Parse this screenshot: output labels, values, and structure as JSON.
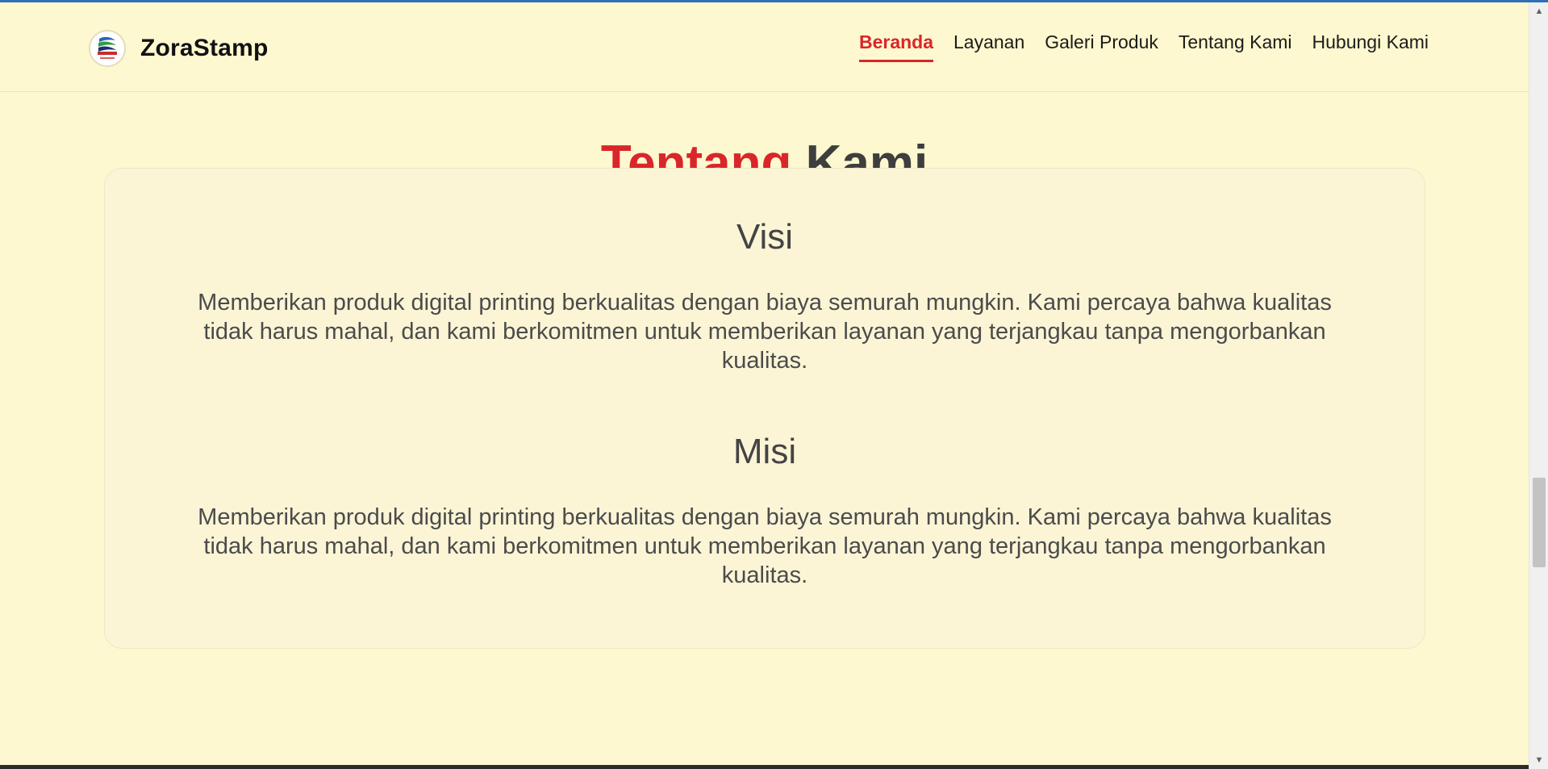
{
  "header": {
    "brand_name": "ZoraStamp",
    "logo_icon": "zora-stamp-logo-icon",
    "nav": [
      {
        "label": "Beranda",
        "active": true
      },
      {
        "label": "Layanan",
        "active": false
      },
      {
        "label": "Galeri Produk",
        "active": false
      },
      {
        "label": "Tentang Kami",
        "active": false
      },
      {
        "label": "Hubungi Kami",
        "active": false
      }
    ]
  },
  "section": {
    "title_accent": "Tentang",
    "title_rest": "Kami",
    "visi": {
      "heading": "Visi",
      "text": "Memberikan produk digital printing berkualitas dengan biaya semurah mungkin. Kami percaya bahwa kualitas tidak harus mahal, dan kami berkomitmen untuk memberikan layanan yang terjangkau tanpa mengorbankan kualitas."
    },
    "misi": {
      "heading": "Misi",
      "text": "Memberikan produk digital printing berkualitas dengan biaya semurah mungkin. Kami percaya bahwa kualitas tidak harus mahal, dan kami berkomitmen untuk memberikan layanan yang terjangkau tanpa mengorbankan kualitas."
    }
  },
  "colors": {
    "background": "#fdf8cf",
    "accent": "#d9262b",
    "card": "#fbf5d6",
    "text": "#4b4b4b"
  },
  "scrollbar": {
    "up_icon": "scroll-up-arrow-icon",
    "down_icon": "scroll-down-arrow-icon"
  }
}
